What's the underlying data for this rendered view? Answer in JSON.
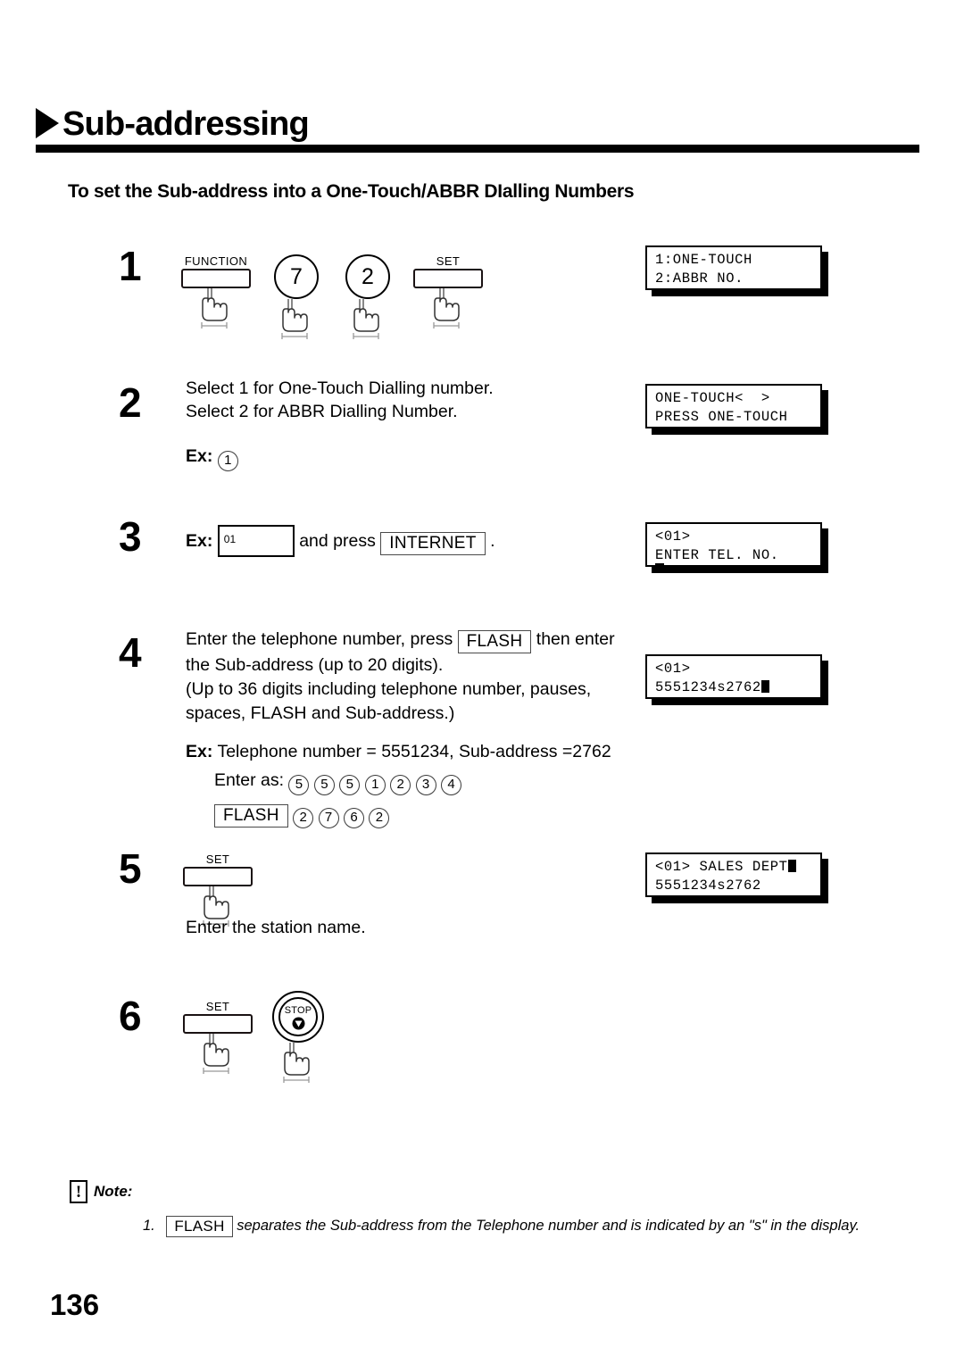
{
  "header": {
    "title": "Sub-addressing",
    "marker_icon": "triangle-right-icon",
    "subtitle": "To set the Sub-address into a One-Touch/ABBR DIalling Numbers"
  },
  "steps": [
    {
      "number": "1",
      "keys": [
        {
          "type": "cap",
          "label": "FUNCTION"
        },
        {
          "type": "round",
          "label": "7"
        },
        {
          "type": "round",
          "label": "2"
        },
        {
          "type": "cap",
          "label": "SET"
        }
      ]
    },
    {
      "number": "2",
      "line1": "Select 1 for One-Touch Dialling number.",
      "line2": "Select 2 for ABBR Dialling Number.",
      "ex_label": "Ex:",
      "ex_digit": "1"
    },
    {
      "number": "3",
      "ex_label": "Ex:",
      "box_value": "01",
      "mid_text": "and press",
      "key_label": "INTERNET",
      "end_text": "."
    },
    {
      "number": "4",
      "line1a": "Enter the telephone number, press",
      "key_label": "FLASH",
      "line1b": "then enter",
      "line2": "the Sub-address (up to 20 digits).",
      "line3": "(Up to 36 digits including telephone number, pauses,",
      "line4": "spaces, FLASH and Sub-address.)",
      "ex_label": "Ex:",
      "ex_text": "Telephone number = 5551234, Sub-address =2762",
      "enter_as_label": "Enter as:",
      "enter_as_digits": [
        "5",
        "5",
        "5",
        "1",
        "2",
        "3",
        "4"
      ],
      "flash_key_label": "FLASH",
      "subaddress_digits": [
        "2",
        "7",
        "6",
        "2"
      ]
    },
    {
      "number": "5",
      "keys": [
        {
          "type": "cap",
          "label": "SET"
        }
      ],
      "caption": "Enter the station name."
    },
    {
      "number": "6",
      "keys": [
        {
          "type": "cap",
          "label": "SET"
        },
        {
          "type": "stop",
          "label": "STOP"
        }
      ]
    }
  ],
  "displays": [
    {
      "line1": "1:ONE-TOUCH",
      "line2": "2:ABBR NO."
    },
    {
      "line1": "ONE-TOUCH<  >",
      "line2": "PRESS ONE-TOUCH"
    },
    {
      "line1": "<01>",
      "line2": "ENTER TEL. NO."
    },
    {
      "line1": "<01>",
      "line2": "5551234s2762"
    },
    {
      "line1": "<01> SALES DEPT",
      "line2": "5551234s2762"
    }
  ],
  "note": {
    "icon": "exclamation-icon",
    "bang": "!",
    "label": "Note:",
    "index": "1.",
    "key_label": "FLASH",
    "text": "separates the Sub-address from the Telephone number and is indicated by an \"s\" in the display."
  },
  "page_number": "136",
  "colors": {
    "ink": "#000000",
    "paper": "#ffffff",
    "key_outline": "#1a1213"
  }
}
